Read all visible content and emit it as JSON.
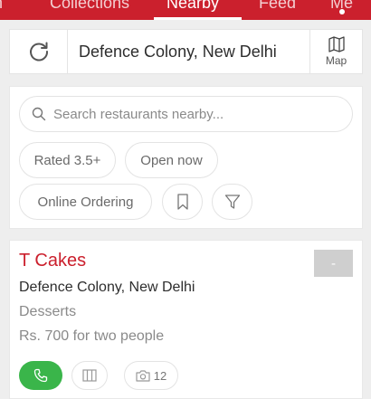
{
  "top_nav": {
    "tabs": [
      {
        "label": "h"
      },
      {
        "label": "Collections"
      },
      {
        "label": "Nearby"
      },
      {
        "label": "Feed"
      },
      {
        "label": "Me"
      }
    ],
    "active_tab": "Nearby",
    "bg_color": "#cb202d"
  },
  "location_bar": {
    "location": "Defence Colony, New Delhi",
    "map_label": "Map",
    "icons": {
      "refresh": "refresh-icon",
      "map": "map-icon"
    }
  },
  "filters": {
    "search_placeholder": "Search restaurants nearby...",
    "chips": {
      "rated": "Rated 3.5+",
      "open_now": "Open now",
      "online_ordering": "Online Ordering"
    },
    "icons": {
      "search": "search-icon",
      "bookmark": "bookmark-icon",
      "filter": "filter-icon"
    }
  },
  "restaurant": {
    "name": "T Cakes",
    "location": "Defence Colony, New Delhi",
    "cuisine": "Desserts",
    "cost": "Rs. 700 for two people",
    "rating": "-",
    "photo_count": "12",
    "icons": {
      "call": "phone-icon",
      "menu": "menu-book-icon",
      "photos": "camera-icon"
    },
    "colors": {
      "name": "#cb202d",
      "call_button": "#3ab54a",
      "rating_badge": "#cfcfcf"
    }
  }
}
